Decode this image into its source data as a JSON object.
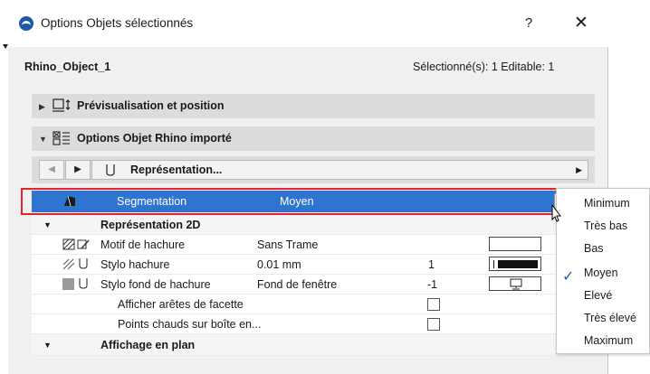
{
  "window": {
    "title": "Options Objets sélectionnés",
    "help": "?",
    "close": "✕"
  },
  "header": {
    "object_name": "Rhino_Object_1",
    "selection_info": "Sélectionné(s): 1 Editable: 1"
  },
  "sections": {
    "preview": "Prévisualisation et position",
    "options": "Options Objet Rhino importé"
  },
  "navbar": {
    "label": "Représentation..."
  },
  "rows": {
    "segmentation": {
      "label": "Segmentation",
      "value": "Moyen"
    },
    "group_2d": {
      "label": "Représentation 2D"
    },
    "motif": {
      "label": "Motif de hachure",
      "value": "Sans Trame"
    },
    "stylo_hachure": {
      "label": "Stylo hachure",
      "value": "0.01 mm",
      "number": "1"
    },
    "stylo_fond": {
      "label": "Stylo fond de hachure",
      "value": "Fond de fenêtre",
      "number": "-1"
    },
    "aretes": {
      "label": "Afficher arêtes de facette",
      "checked": false
    },
    "points": {
      "label": "Points chauds sur boîte en...",
      "checked": false
    },
    "group_plan": {
      "label": "Affichage en plan"
    }
  },
  "dropdown": {
    "options": [
      "Minimum",
      "Très bas",
      "Bas",
      "Moyen",
      "Elevé",
      "Très élevé",
      "Maximum"
    ],
    "selected": "Moyen",
    "check": "✓"
  },
  "colors": {
    "selection": "#2f74d0",
    "highlight_frame": "#e8212b"
  }
}
